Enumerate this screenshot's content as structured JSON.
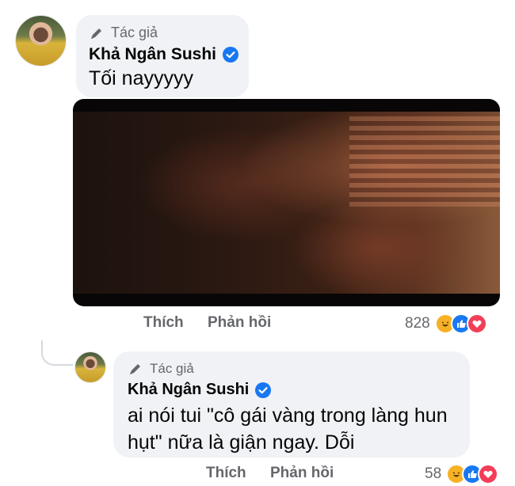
{
  "comments": [
    {
      "author_badge": "Tác giả",
      "author_name": "Khả Ngân Sushi",
      "text": "Tối nayyyyy",
      "like_label": "Thích",
      "reply_label": "Phản hồi",
      "reaction_count": "828",
      "reactions": [
        "haha-icon",
        "like-icon",
        "love-icon"
      ]
    },
    {
      "author_badge": "Tác giả",
      "author_name": "Khả Ngân Sushi",
      "text_line1": "ai nói tui \"cô gái vàng trong làng hun",
      "text_line2": "hụt\" nữa là giận ngay. Dỗi",
      "like_label": "Thích",
      "reply_label": "Phản hồi",
      "reaction_count": "58",
      "reactions": [
        "haha-icon",
        "like-icon",
        "love-icon"
      ]
    }
  ],
  "colors": {
    "bubble": "#f0f2f5",
    "muted_text": "#65676b",
    "verified": "#1877f2",
    "like": "#1877f2",
    "love": "#f33e58",
    "haha": "#f7b125"
  }
}
